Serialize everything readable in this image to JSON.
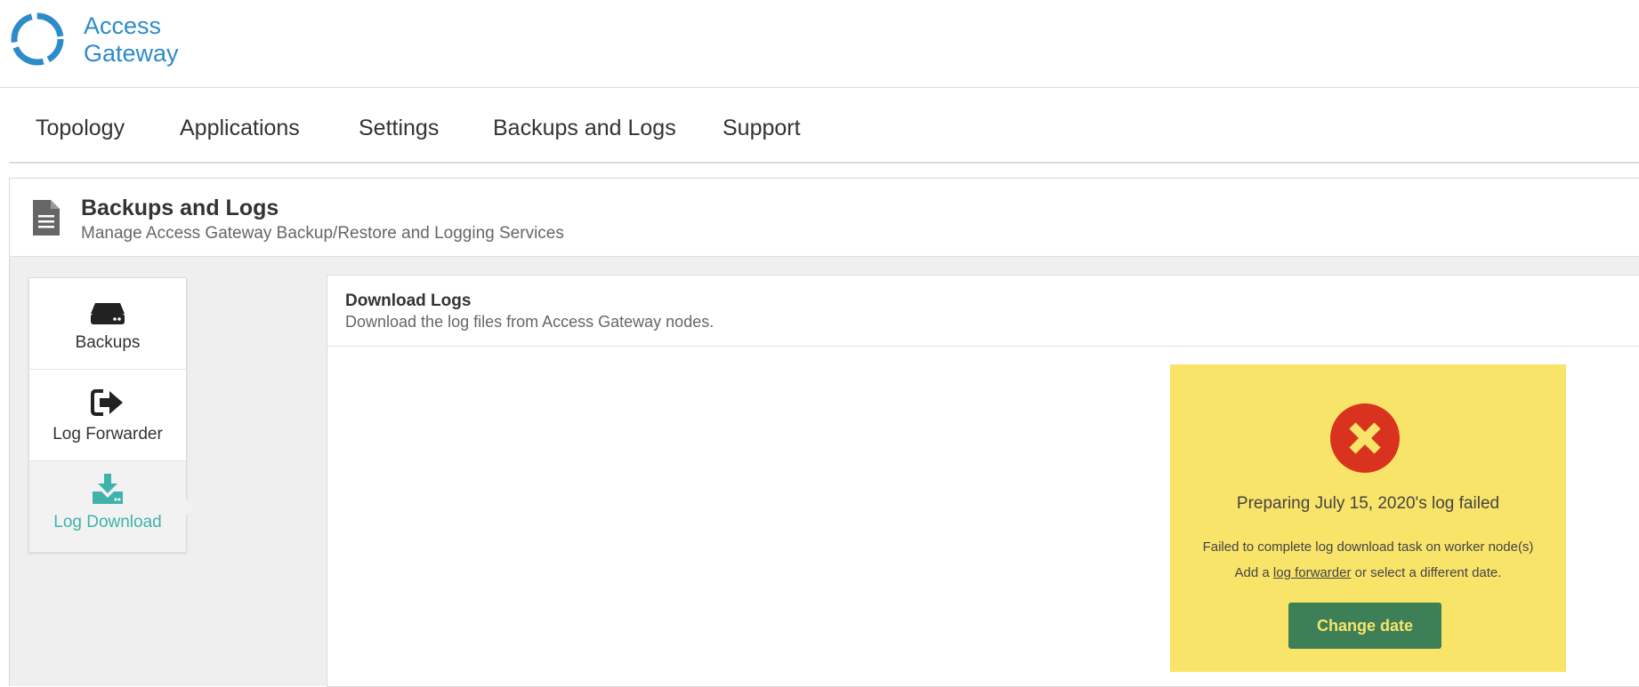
{
  "app": {
    "logo_line1": "Access",
    "logo_line2": "Gateway",
    "brand_color": "#2e8bc9"
  },
  "nav": {
    "items": [
      {
        "label": "Topology"
      },
      {
        "label": "Applications"
      },
      {
        "label": "Settings"
      },
      {
        "label": "Backups and Logs"
      },
      {
        "label": "Support"
      }
    ]
  },
  "page": {
    "icon": "document-icon",
    "title": "Backups and Logs",
    "subtitle": "Manage Access Gateway Backup/Restore and Logging Services"
  },
  "sidebar": {
    "items": [
      {
        "label": "Backups",
        "icon": "hard-drive-icon"
      },
      {
        "label": "Log Forwarder",
        "icon": "sign-out-icon"
      },
      {
        "label": "Log Download",
        "icon": "download-icon",
        "active": true
      }
    ],
    "active_color": "#3fb3ab"
  },
  "panel": {
    "title": "Download Logs",
    "subtitle": "Download the log files from Access Gateway nodes."
  },
  "alert": {
    "icon": "error-x-icon",
    "title": "Preparing July 15, 2020's log failed",
    "message1": "Failed to complete log download task on worker node(s)",
    "message2_prefix": "Add a ",
    "message2_link": "log forwarder",
    "message2_suffix": " or select a different date.",
    "button_label": "Change date",
    "background_color": "#f9e46a",
    "button_color": "#3d7f57",
    "error_color": "#d9331f"
  }
}
